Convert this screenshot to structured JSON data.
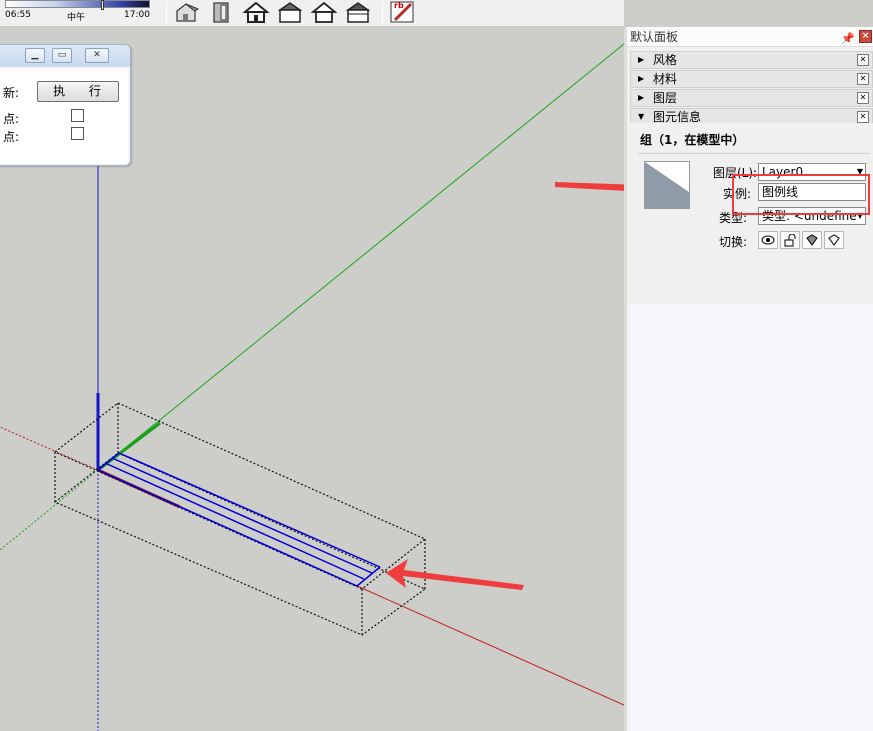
{
  "toolbar": {
    "time_start": "06:55",
    "time_mid": "中午",
    "time_end": "17:00",
    "shadow_position": 0.66,
    "buttons": [
      {
        "name": "iso-view-button",
        "icon": "house-iso-icon"
      },
      {
        "name": "front-view-button",
        "icon": "house-front-icon"
      },
      {
        "name": "home-view-button",
        "icon": "house-icon"
      },
      {
        "name": "back-view-button",
        "icon": "house-outline-icon"
      },
      {
        "name": "left-view-button",
        "icon": "house-roof-icon"
      },
      {
        "name": "right-view-button",
        "icon": "house-box-icon"
      }
    ],
    "ruby_button_label": "rb"
  },
  "dialog": {
    "row1_label": "新:",
    "execute_button": "执 行",
    "row2_label": "点:",
    "row3_label": "点:"
  },
  "tray": {
    "title": "默认面板",
    "pin": "ᵖ",
    "sections": [
      {
        "label": "风格",
        "arrow": "▶"
      },
      {
        "label": "材料",
        "arrow": "▶"
      },
      {
        "label": "图层",
        "arrow": "▶"
      },
      {
        "label": "图元信息",
        "arrow": "▼"
      }
    ],
    "entity": {
      "title": "组（1，在模型中）",
      "layer_label": "图层(L):",
      "layer_value": "Layer0",
      "instance_label": "实例:",
      "instance_value": "图例线",
      "type_label": "类型:",
      "type_value": "类型: <undefine",
      "toggle_label": "切换:"
    }
  },
  "colors": {
    "annotation": "#ee3d3d",
    "axis_red": "#c11f1f",
    "axis_green": "#1aa81a",
    "axis_blue": "#1a1acc",
    "selection": "#0000dd",
    "viewport_bg": "#cdcdc9"
  }
}
